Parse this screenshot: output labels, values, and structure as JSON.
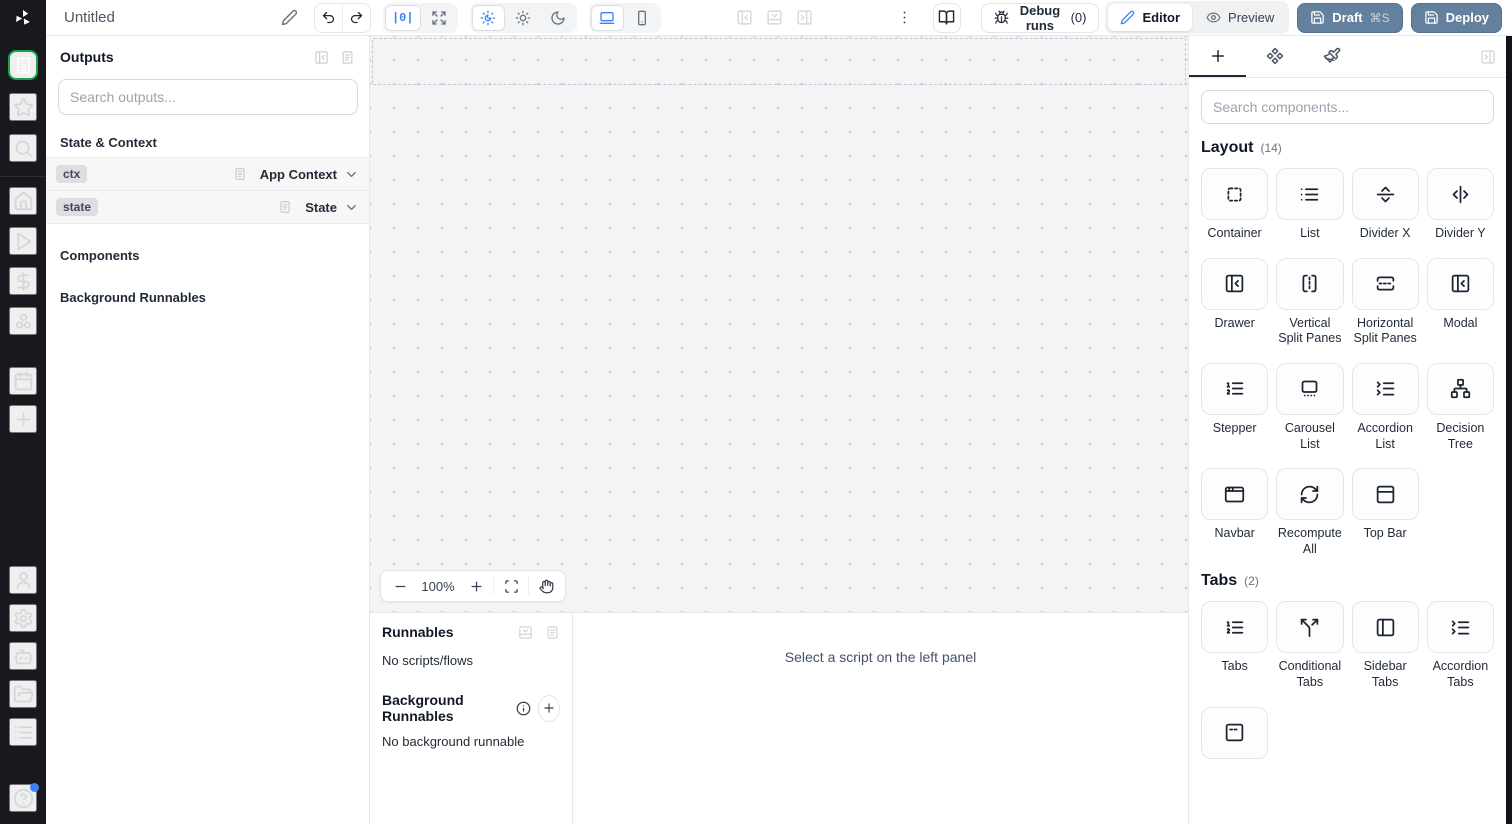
{
  "topbar": {
    "title": "Untitled",
    "zoom_fit_label": "|0|",
    "debug_runs_label": "Debug runs",
    "debug_runs_count": "(0)",
    "editor_label": "Editor",
    "preview_label": "Preview",
    "draft_label": "Draft",
    "draft_shortcut": "⌘S",
    "deploy_label": "Deploy",
    "icon_buttons": [
      "pencil-icon",
      "undo-icon",
      "redo-icon",
      "zoom-fit-button",
      "expand-icon",
      "theme-auto-icon",
      "theme-light-icon",
      "theme-dark-icon",
      "device-desktop-icon",
      "device-mobile-icon",
      "panel-left-toggle-icon",
      "panel-bottom-toggle-icon",
      "panel-right-toggle-icon",
      "kebab-menu-icon",
      "docs-book-icon",
      "bug-icon",
      "eye-icon",
      "save-icon"
    ]
  },
  "left_rail": {
    "groups": [
      {
        "items": [
          {
            "name": "apps",
            "icon": "building",
            "selected": true
          },
          {
            "name": "favorites",
            "icon": "star"
          },
          {
            "name": "search",
            "icon": "search"
          }
        ]
      },
      {
        "items": [
          {
            "name": "home",
            "icon": "home"
          },
          {
            "name": "runs",
            "icon": "play"
          },
          {
            "name": "variables",
            "icon": "dollar"
          },
          {
            "name": "resources",
            "icon": "circles"
          }
        ]
      },
      {
        "items": [
          {
            "name": "schedules",
            "icon": "calendar"
          },
          {
            "name": "add",
            "icon": "plus"
          }
        ]
      },
      {
        "items": [
          {
            "name": "user",
            "icon": "user"
          },
          {
            "name": "settings",
            "icon": "settings"
          },
          {
            "name": "workers",
            "icon": "bot"
          },
          {
            "name": "folders",
            "icon": "folder-open"
          },
          {
            "name": "logs",
            "icon": "list-bullets"
          }
        ]
      },
      {
        "items": [
          {
            "name": "help",
            "icon": "help-circle",
            "badge": true
          }
        ]
      }
    ]
  },
  "outputs_panel": {
    "title": "Outputs",
    "search_placeholder": "Search outputs...",
    "state_context_heading": "State & Context",
    "rows": [
      {
        "badge": "ctx",
        "value": "App Context"
      },
      {
        "badge": "state",
        "value": "State"
      }
    ],
    "components_heading": "Components",
    "background_runnables_heading": "Background Runnables"
  },
  "canvas": {
    "zoom_level": "100%"
  },
  "bottom_panel": {
    "runnables_title": "Runnables",
    "runnables_empty": "No scripts/flows",
    "background_title": "Background Runnables",
    "background_empty": "No background runnable",
    "select_hint": "Select a script on the left panel"
  },
  "components_panel": {
    "search_placeholder": "Search components...",
    "sections": [
      {
        "title": "Layout",
        "count": "(14)",
        "items": [
          {
            "label": "Container",
            "icon": "container"
          },
          {
            "label": "List",
            "icon": "list"
          },
          {
            "label": "Divider X",
            "icon": "divider-x"
          },
          {
            "label": "Divider Y",
            "icon": "divider-y"
          },
          {
            "label": "Drawer",
            "icon": "panel-left-close"
          },
          {
            "label": "Vertical Split Panes",
            "icon": "vsplit"
          },
          {
            "label": "Horizontal Split Panes",
            "icon": "hsplit"
          },
          {
            "label": "Modal",
            "icon": "panel-left-close"
          },
          {
            "label": "Stepper",
            "icon": "list-ordered"
          },
          {
            "label": "Carousel List",
            "icon": "carousel"
          },
          {
            "label": "Accordion List",
            "icon": "list-collapse"
          },
          {
            "label": "Decision Tree",
            "icon": "network"
          },
          {
            "label": "Navbar",
            "icon": "app-window"
          },
          {
            "label": "Recompute All",
            "icon": "refresh-cw"
          },
          {
            "label": "Top Bar",
            "icon": "panel-top"
          }
        ]
      },
      {
        "title": "Tabs",
        "count": "(2)",
        "items": [
          {
            "label": "Tabs",
            "icon": "list-ordered"
          },
          {
            "label": "Conditional Tabs",
            "icon": "split"
          },
          {
            "label": "Sidebar Tabs",
            "icon": "panel-left"
          },
          {
            "label": "Accordion Tabs",
            "icon": "list-collapse"
          },
          {
            "label": "",
            "icon": "invisible-tabs"
          }
        ]
      }
    ]
  },
  "colors": {
    "accent_blue": "#3b82f6",
    "selected_green": "#16a34a",
    "deploy_button": "#64809f",
    "rail_background": "#17191e"
  }
}
